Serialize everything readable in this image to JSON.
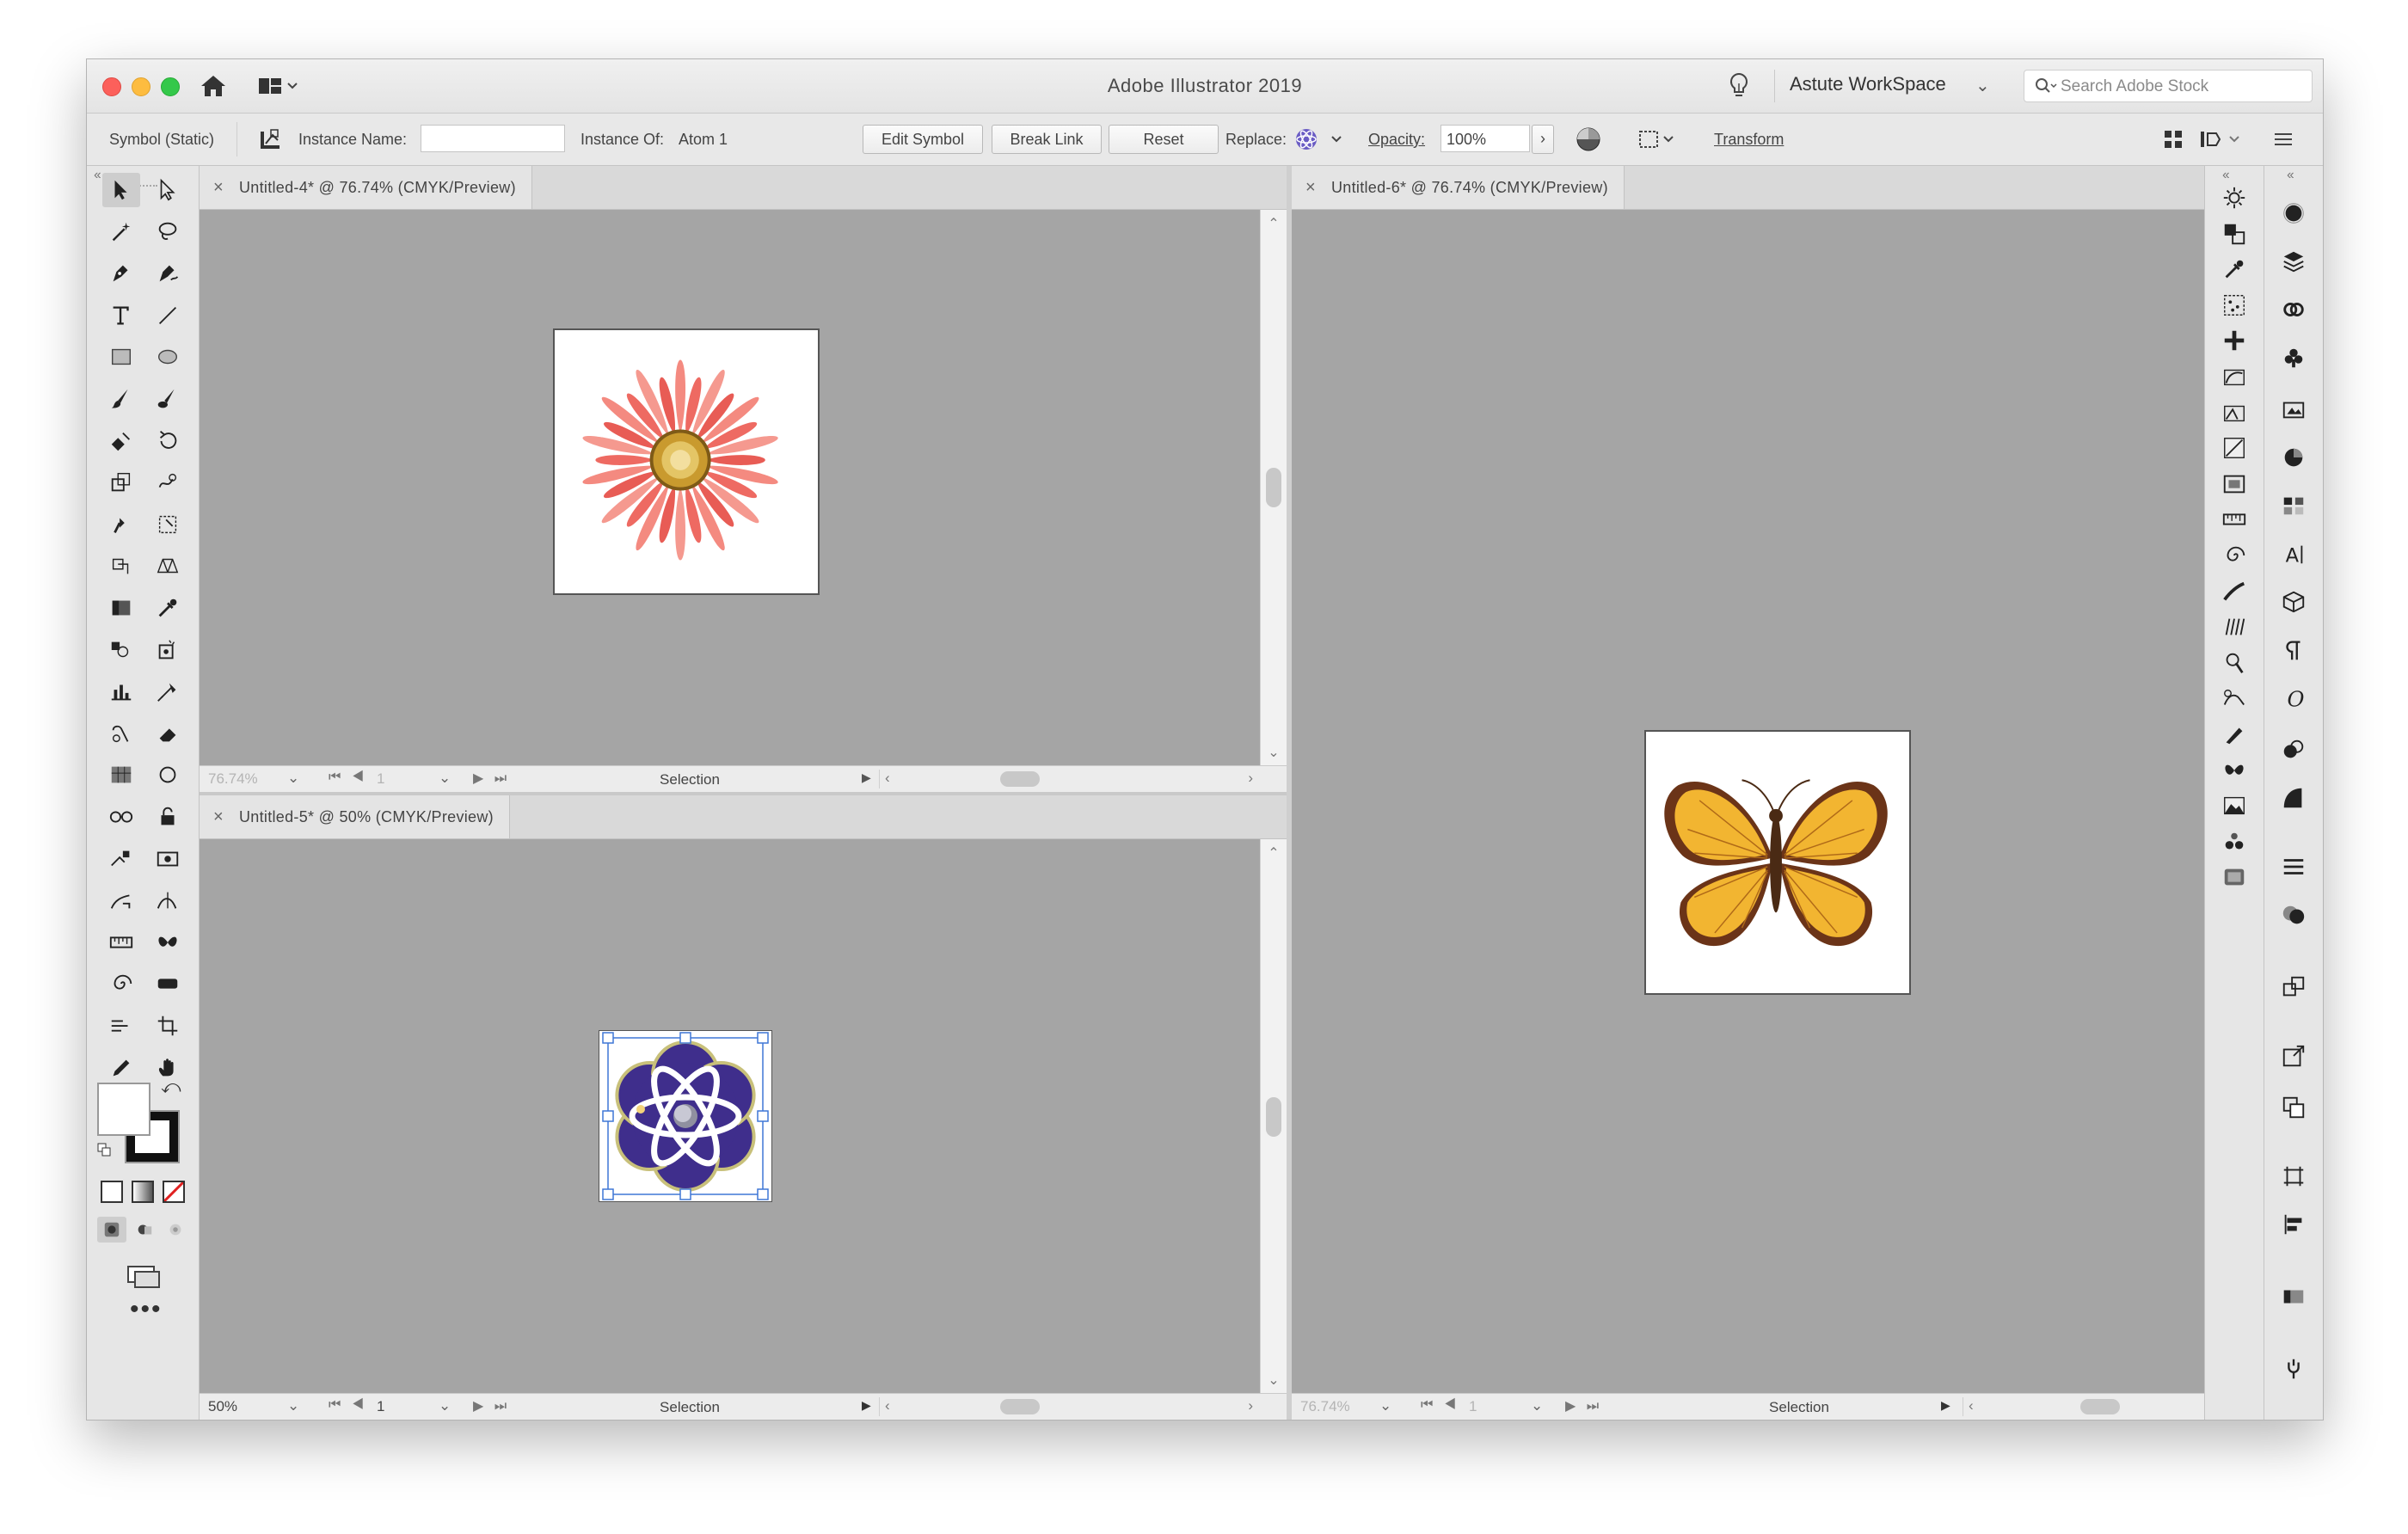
{
  "window": {
    "title": "Adobe Illustrator 2019",
    "workspace": "Astute WorkSpace",
    "search_placeholder": "Search Adobe Stock"
  },
  "controlbar": {
    "selection_type": "Symbol (Static)",
    "instance_name_label": "Instance Name:",
    "instance_name_value": "",
    "instance_of_label": "Instance Of:",
    "instance_of_value": "Atom 1",
    "edit_symbol": "Edit Symbol",
    "break_link": "Break Link",
    "reset": "Reset",
    "replace_label": "Replace:",
    "opacity_label": "Opacity:",
    "opacity_value": "100%",
    "transform": "Transform"
  },
  "documents": [
    {
      "tab": "Untitled-4* @ 76.74% (CMYK/Preview)",
      "zoom": "76.74%",
      "page": "1",
      "mode": "Selection",
      "artwork": "flower"
    },
    {
      "tab": "Untitled-5* @ 50% (CMYK/Preview)",
      "zoom": "50%",
      "page": "1",
      "mode": "Selection",
      "artwork": "atom"
    },
    {
      "tab": "Untitled-6* @ 76.74% (CMYK/Preview)",
      "zoom": "76.74%",
      "page": "1",
      "mode": "Selection",
      "artwork": "butterfly"
    }
  ],
  "colors": {
    "flower_petal": "#f0706a",
    "flower_center": "#c99a2e",
    "atom_fill": "#3f2e8c",
    "butterfly_wing": "#f2b531",
    "butterfly_edge": "#6b3418",
    "canvas_bg": "#a5a5a5"
  }
}
